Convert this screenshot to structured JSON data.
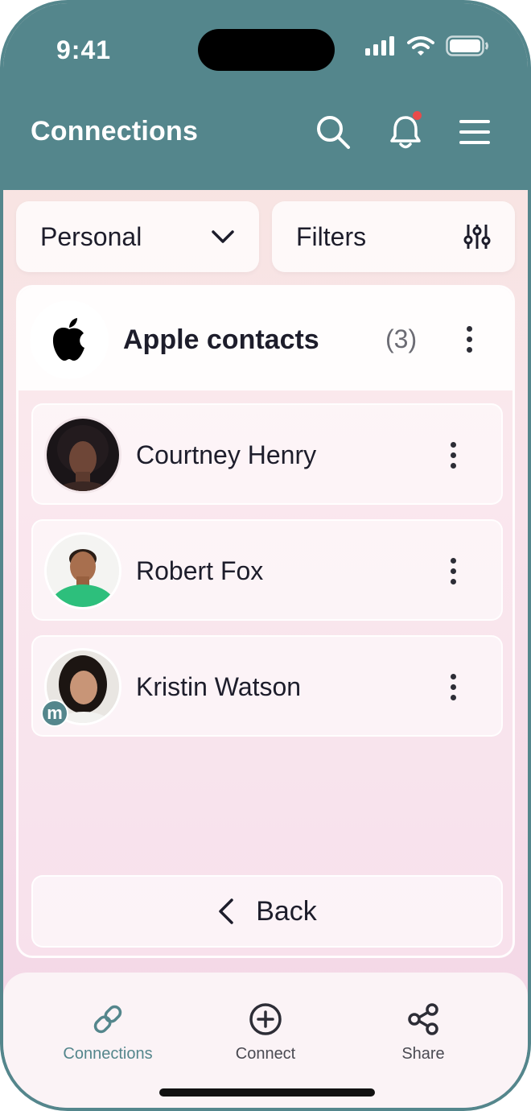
{
  "status_bar": {
    "time": "9:41"
  },
  "header": {
    "title": "Connections",
    "icons": [
      "search-icon",
      "bell-icon",
      "menu-icon"
    ],
    "has_notification": true
  },
  "selectors": {
    "category": {
      "value": "Personal",
      "icon": "chevron-down-icon"
    },
    "filters": {
      "label": "Filters",
      "icon": "sliders-icon"
    }
  },
  "group": {
    "title": "Apple contacts",
    "count": "(3)",
    "icon": "apple-icon",
    "contacts": [
      {
        "name": "Courtney Henry",
        "badge": ""
      },
      {
        "name": "Robert Fox",
        "badge": ""
      },
      {
        "name": "Kristin Watson",
        "badge": "m"
      }
    ]
  },
  "back": {
    "label": "Back"
  },
  "tabbar": {
    "tabs": [
      {
        "label": "Connections",
        "icon": "link-icon",
        "active": true
      },
      {
        "label": "Connect",
        "icon": "plus-circle-icon",
        "active": false
      },
      {
        "label": "Share",
        "icon": "share-icon",
        "active": false
      }
    ]
  },
  "colors": {
    "brand": "#54868c",
    "notification": "#e84b4b",
    "text": "#1d1d2b"
  }
}
